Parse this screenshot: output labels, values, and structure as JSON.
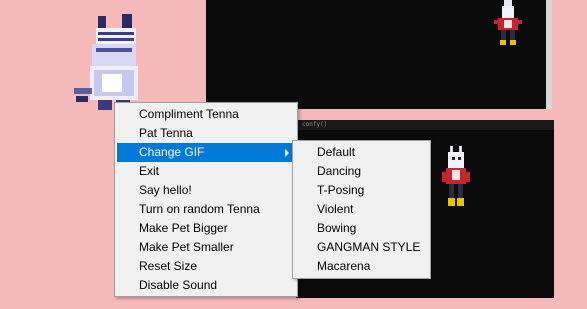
{
  "context_menu": {
    "items": [
      {
        "label": "Compliment Tenna"
      },
      {
        "label": "Pat Tenna"
      },
      {
        "label": "Change GIF",
        "highlighted": true,
        "has_submenu": true
      },
      {
        "label": "Exit"
      },
      {
        "label": "Say hello!"
      },
      {
        "label": "Turn on random Tenna"
      },
      {
        "label": "Make Pet Bigger"
      },
      {
        "label": "Make Pet Smaller"
      },
      {
        "label": "Reset Size"
      },
      {
        "label": "Disable Sound"
      }
    ]
  },
  "gif_submenu": {
    "items": [
      {
        "label": "Default"
      },
      {
        "label": "Dancing"
      },
      {
        "label": "T-Posing"
      },
      {
        "label": "Violent"
      },
      {
        "label": "Bowing"
      },
      {
        "label": "GANGMAN STYLE"
      },
      {
        "label": "Macarena"
      }
    ]
  },
  "code_strip": {
    "text": "confy()"
  },
  "colors": {
    "desktop_bg": "#f6b9b9",
    "window_bg": "#0b0b0b",
    "menu_bg": "#f0f0f0",
    "highlight": "#0078d7"
  }
}
